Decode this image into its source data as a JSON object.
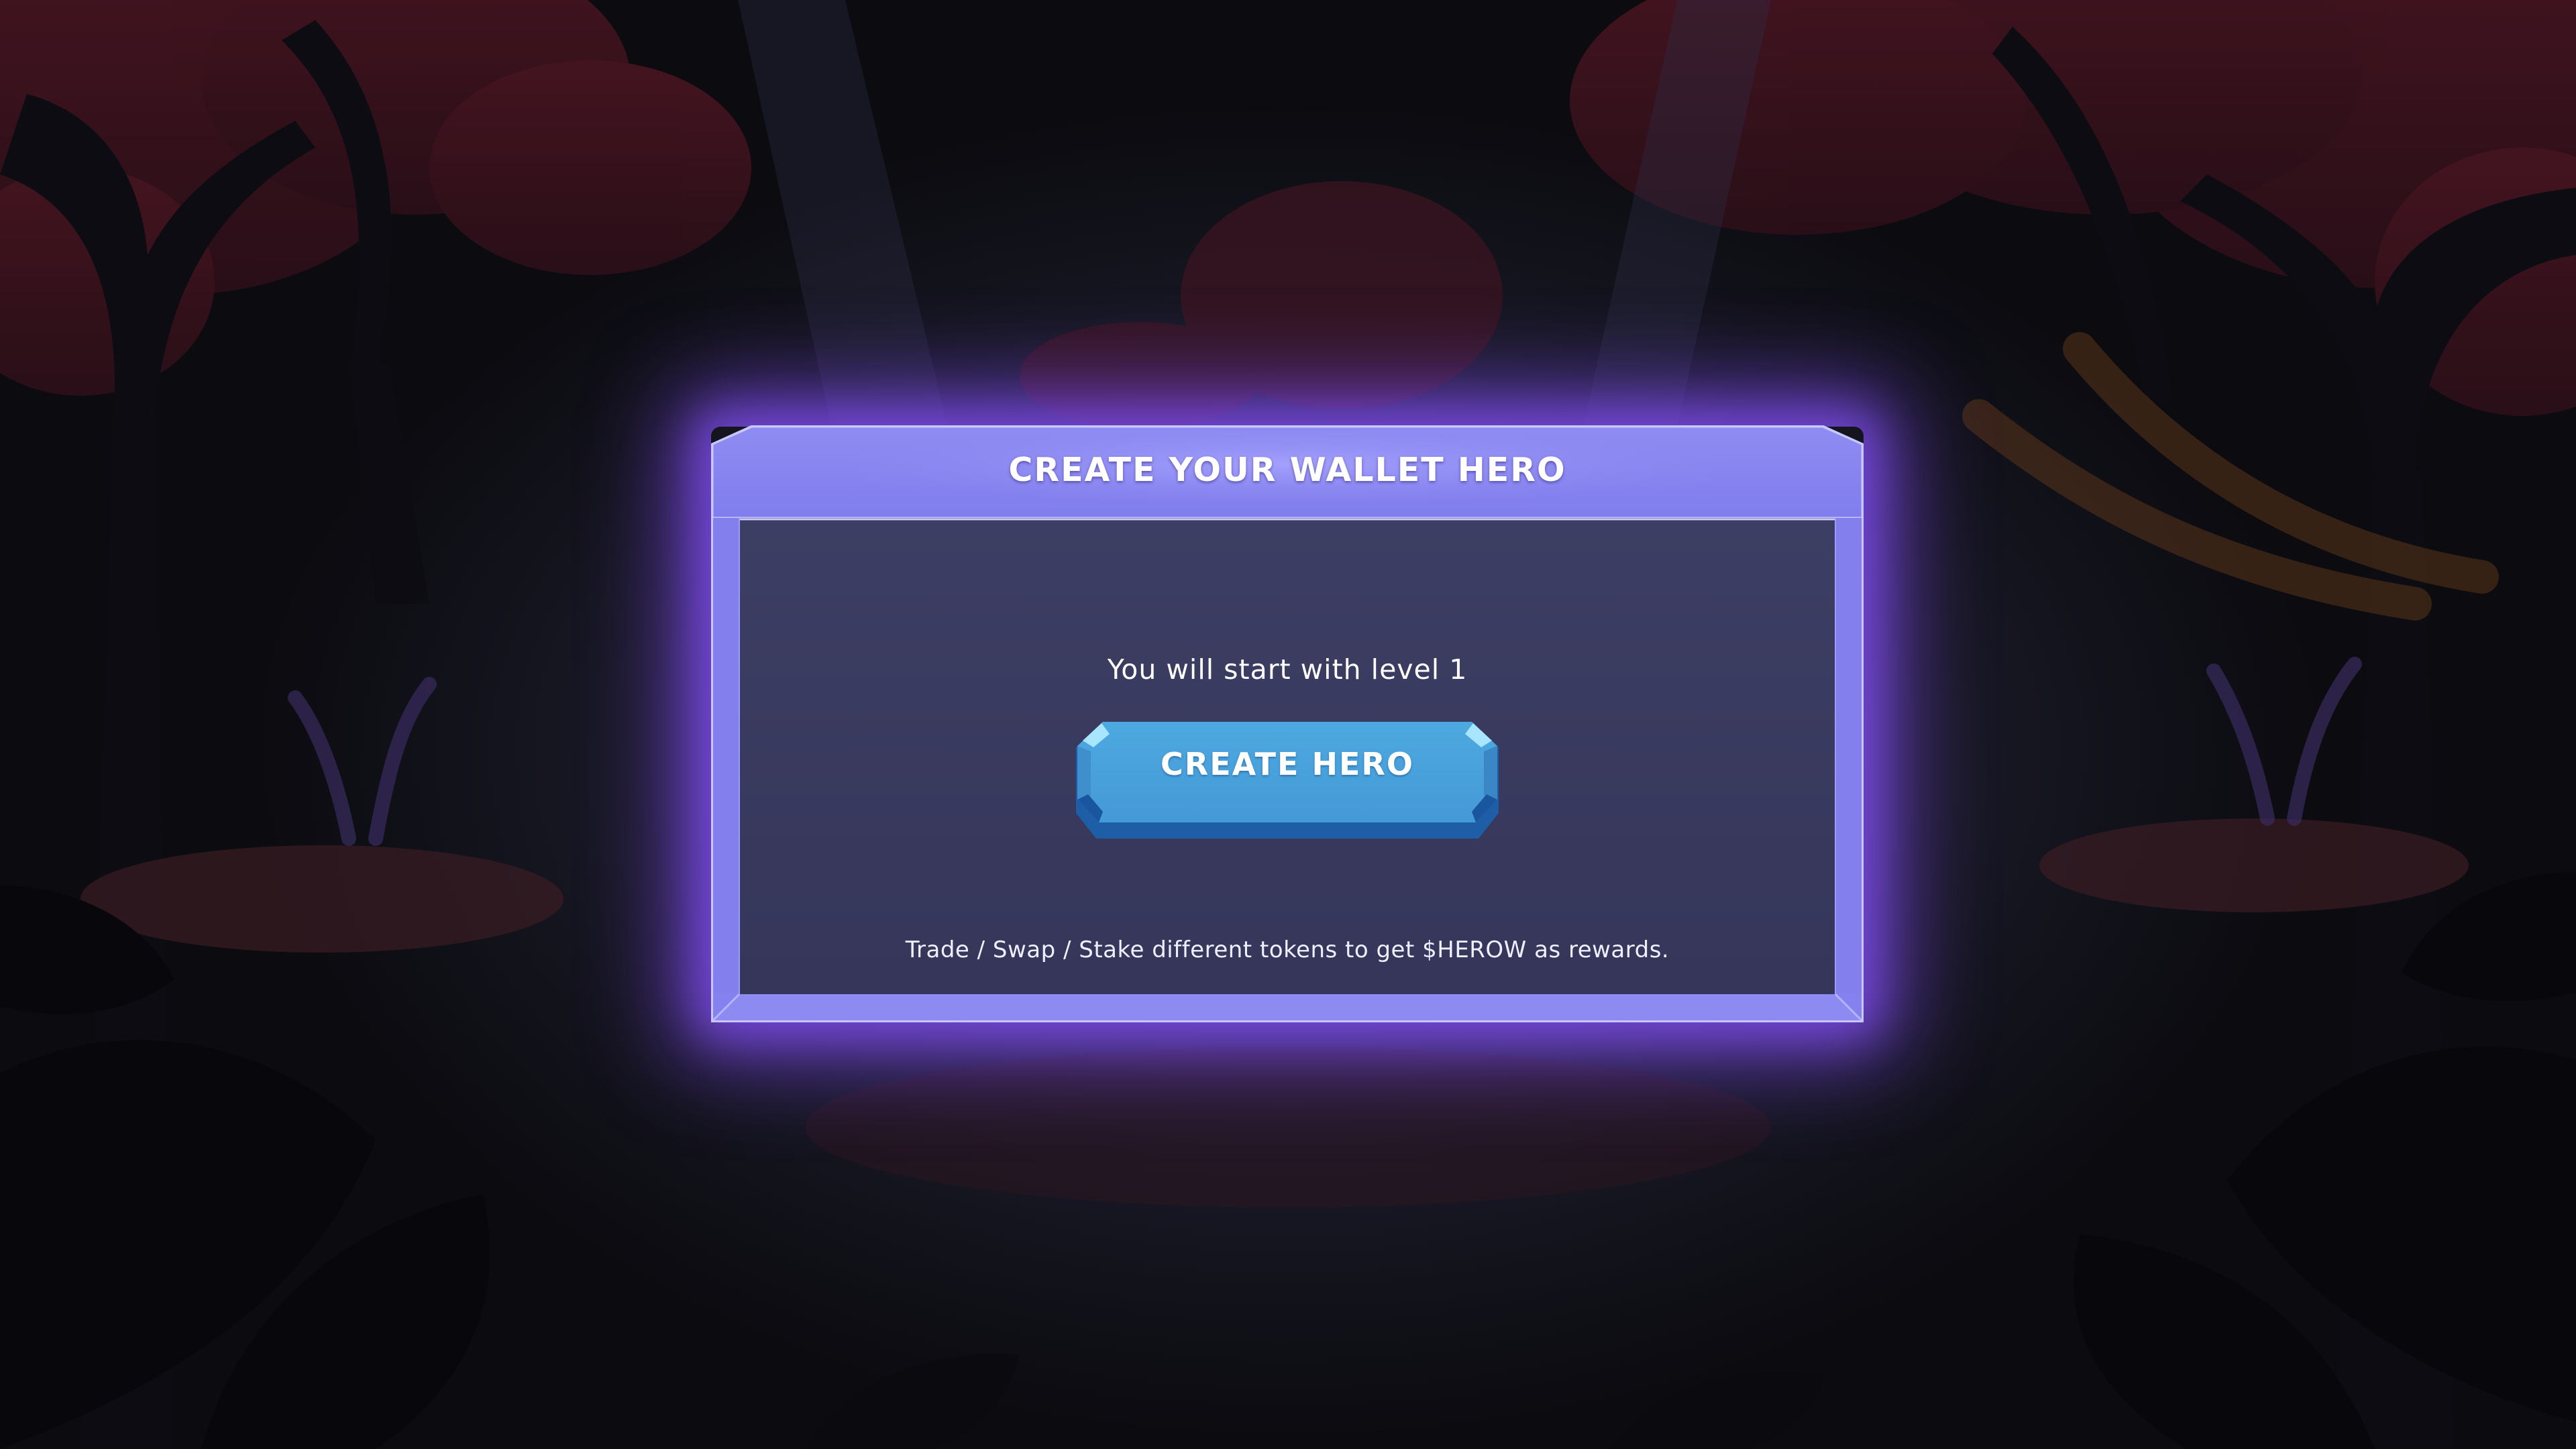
{
  "modal": {
    "title": "CREATE YOUR WALLET HERO",
    "level_text": "You will start with level 1",
    "create_button_label": "CREATE HERO",
    "rewards_text": "Trade / Swap / Stake different tokens to get $HEROW as rewards."
  },
  "colors": {
    "frame_light": "#8f8cf2",
    "frame_mid": "#7b78e8",
    "panel": "#393a5e",
    "button_face": "#4aa3db",
    "button_edge": "#1e62a8",
    "glow": "#7a48e6"
  },
  "scene": {
    "style": "dark fantasy forest with red-leaved trees"
  }
}
